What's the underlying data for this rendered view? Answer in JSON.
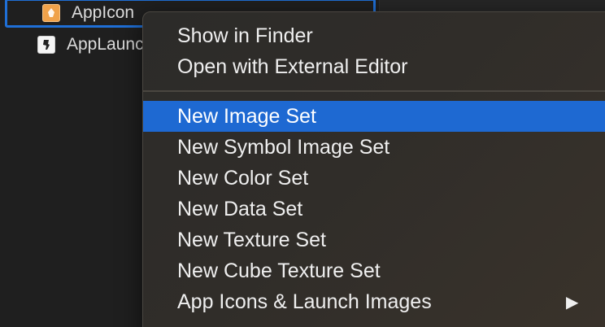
{
  "navigator": {
    "items": [
      {
        "label": "AppIcon",
        "icon": "app-icon-asset",
        "selected": true
      },
      {
        "label": "AppLaunchImage",
        "icon": "launch-image-asset",
        "selected": false
      }
    ]
  },
  "context_menu": {
    "group1": [
      {
        "label": "Show in Finder"
      },
      {
        "label": "Open with External Editor"
      }
    ],
    "group2": [
      {
        "label": "New Image Set",
        "highlighted": true
      },
      {
        "label": "New Symbol Image Set"
      },
      {
        "label": "New Color Set"
      },
      {
        "label": "New Data Set"
      },
      {
        "label": "New Texture Set"
      },
      {
        "label": "New Cube Texture Set"
      },
      {
        "label": "App Icons & Launch Images",
        "submenu_arrow": "▶"
      }
    ]
  },
  "colors": {
    "highlight": "#1e69d2",
    "selection_outline": "#1f6fd6",
    "appicon_orange": "#f0a24a"
  }
}
